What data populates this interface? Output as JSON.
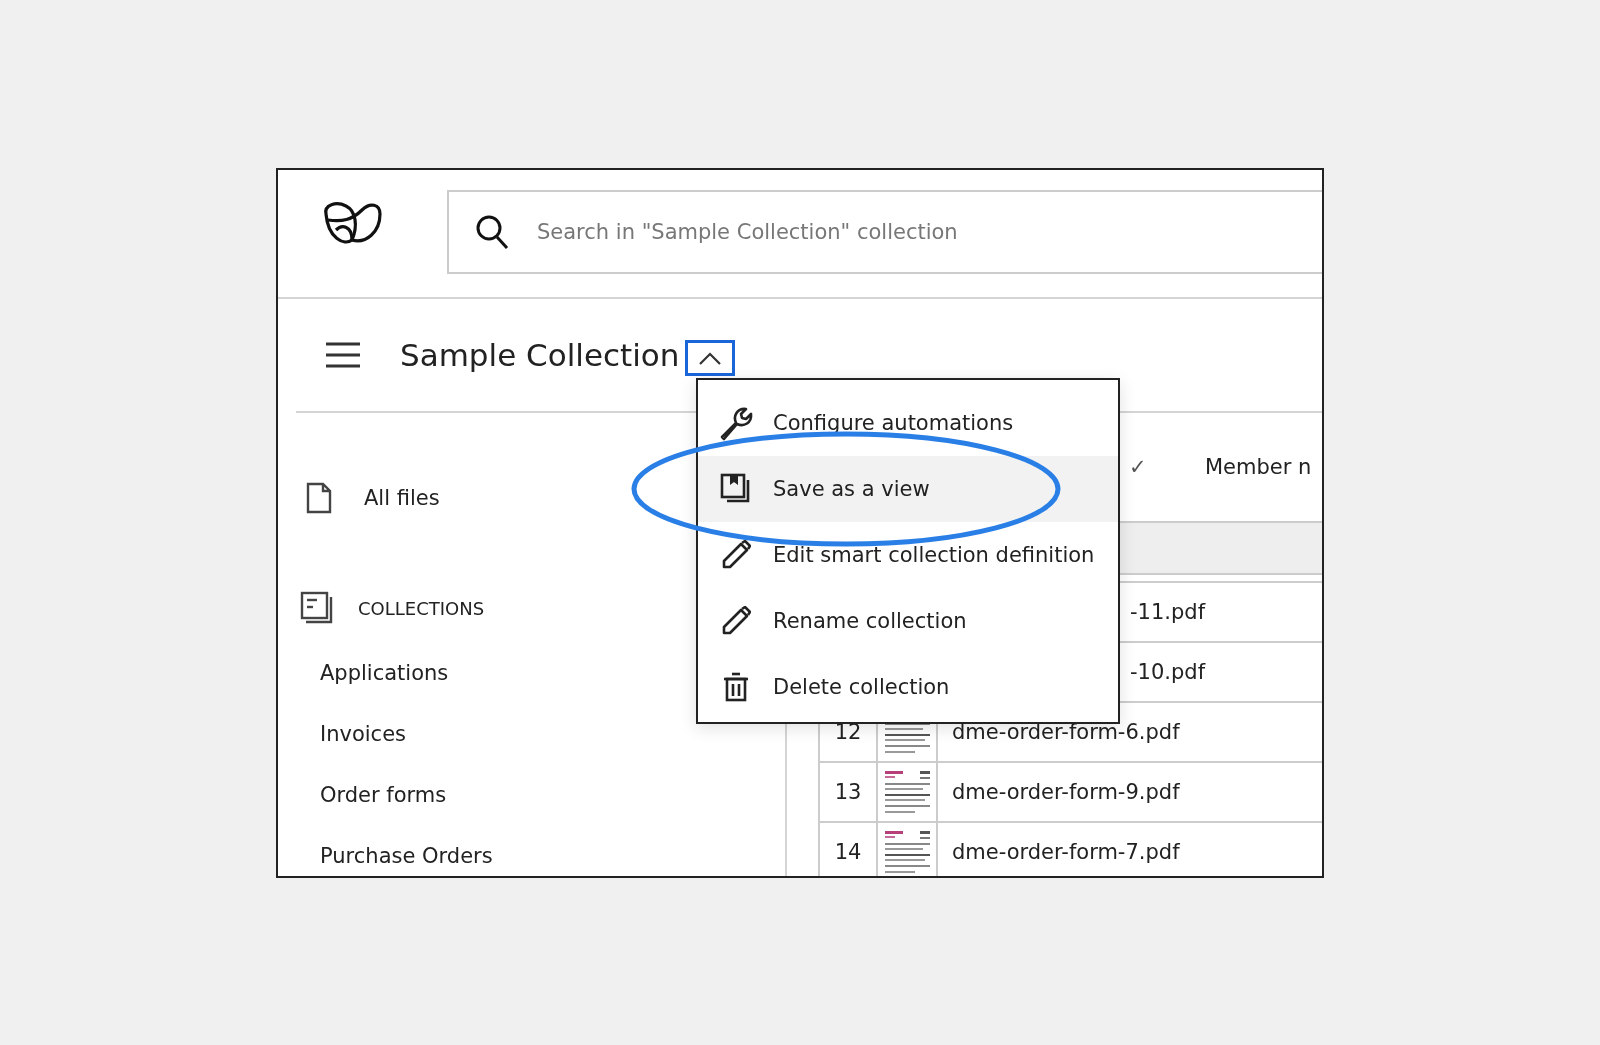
{
  "search": {
    "placeholder": "Search in \"Sample Collection\" collection"
  },
  "collection": {
    "title": "Sample Collection",
    "menu_expanded": true
  },
  "menu": [
    {
      "label": "Configure automations",
      "highlighted": false
    },
    {
      "label": "Save as a view",
      "highlighted": true
    },
    {
      "label": "Edit smart collection definition",
      "highlighted": false
    },
    {
      "label": "Rename collection",
      "highlighted": false
    },
    {
      "label": "Delete collection",
      "highlighted": false
    }
  ],
  "sidebar": {
    "items": [
      {
        "kind": "link",
        "label": "All files"
      },
      {
        "kind": "section",
        "label": "COLLECTIONS"
      },
      {
        "kind": "child",
        "label": "Applications"
      },
      {
        "kind": "child",
        "label": "Invoices"
      },
      {
        "kind": "child",
        "label": "Order forms"
      },
      {
        "kind": "child",
        "label": "Purchase Orders"
      }
    ]
  },
  "table": {
    "columns": [
      "✓",
      "Member n"
    ],
    "rows": [
      {
        "name": "-11.pdf",
        "covered": true
      },
      {
        "name": "-10.pdf",
        "covered": true
      },
      {
        "number": "12",
        "name": "dme-order-form-6.pdf",
        "covered": false
      },
      {
        "number": "13",
        "name": "dme-order-form-9.pdf",
        "covered": false
      },
      {
        "number": "14",
        "name": "dme-order-form-7.pdf",
        "covered": false
      }
    ]
  }
}
